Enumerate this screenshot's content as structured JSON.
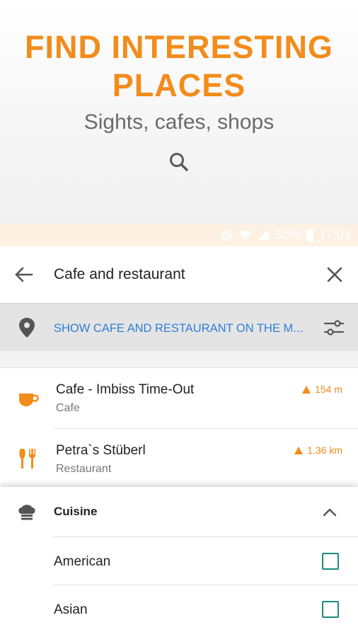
{
  "promo": {
    "title_line1": "FIND INTERESTING",
    "title_line2": "PLACES",
    "subtitle": "Sights, cafes, shops",
    "icon": "search-icon"
  },
  "statusbar": {
    "battery": "50%",
    "time": "17:01"
  },
  "search": {
    "query": "Cafe and restaurant"
  },
  "map_bar": {
    "label": "SHOW CAFE AND RESTAURANT ON THE M..."
  },
  "results": [
    {
      "name": "Cafe - Imbiss Time-Out",
      "type": "Cafe",
      "distance": "154 m",
      "icon": "coffee-cup-icon"
    },
    {
      "name": "Petra`s Stüberl",
      "type": "Restaurant",
      "distance": "1.36 km",
      "icon": "fork-knife-icon"
    }
  ],
  "filter_sheet": {
    "title": "Cuisine",
    "options": [
      {
        "label": "American",
        "checked": false
      },
      {
        "label": "Asian",
        "checked": false
      }
    ]
  },
  "colors": {
    "accent": "#f28c1b",
    "link": "#2f7fd8",
    "checkbox": "#1b8a7e"
  }
}
